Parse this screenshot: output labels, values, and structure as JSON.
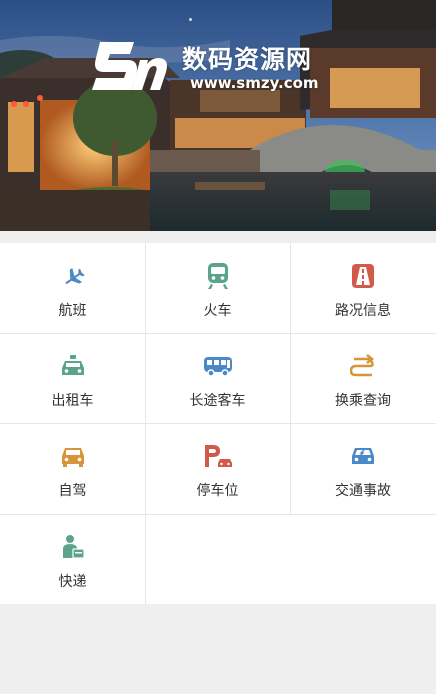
{
  "watermark": {
    "title": "数码资源网",
    "url": "www.smzy.com"
  },
  "colors": {
    "blue": "#4a88c8",
    "green": "#5aa58a",
    "red": "#d25a4a",
    "orange": "#d8943a"
  },
  "services": [
    {
      "label": "航班",
      "icon": "airplane-icon"
    },
    {
      "label": "火车",
      "icon": "train-icon"
    },
    {
      "label": "路况信息",
      "icon": "road-icon"
    },
    {
      "label": "出租车",
      "icon": "taxi-icon"
    },
    {
      "label": "长途客车",
      "icon": "coach-bus-icon"
    },
    {
      "label": "换乘查询",
      "icon": "transfer-icon"
    },
    {
      "label": "自驾",
      "icon": "self-drive-car-icon"
    },
    {
      "label": "停车位",
      "icon": "parking-icon"
    },
    {
      "label": "交通事故",
      "icon": "accident-icon"
    },
    {
      "label": "快递",
      "icon": "courier-icon"
    }
  ]
}
